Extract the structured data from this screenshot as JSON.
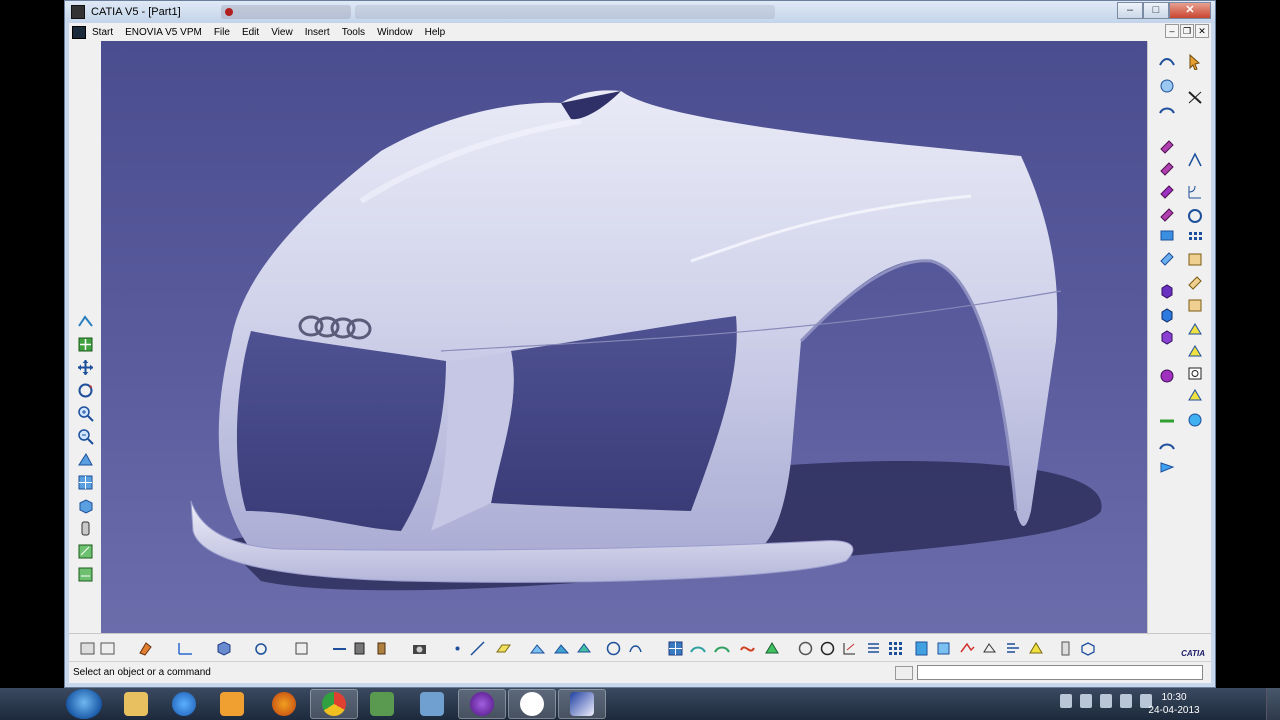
{
  "window": {
    "title": "CATIA V5 - [Part1]",
    "controls": {
      "minimize": "–",
      "maximize": "□",
      "close": "✕"
    },
    "inner_controls": {
      "minimize": "–",
      "restore": "❐",
      "close": "✕"
    }
  },
  "menu": {
    "items": [
      "Start",
      "ENOVIA V5 VPM",
      "File",
      "Edit",
      "View",
      "Insert",
      "Tools",
      "Window",
      "Help"
    ]
  },
  "left_toolbar": {
    "icons": [
      "fly-mode-icon",
      "fit-all-icon",
      "pan-icon",
      "rotate-icon",
      "zoom-in-icon",
      "zoom-out-icon",
      "normal-view-icon",
      "multi-view-icon",
      "isometric-view-icon",
      "shading-icon",
      "hide-show-icon",
      "swap-space-icon"
    ]
  },
  "right_toolbar": {
    "icons": [
      "sketcher-icon",
      "select-icon",
      "pad-icon",
      "pocket-icon",
      "shaft-icon",
      "groove-icon",
      "hole-icon",
      "rib-icon",
      "slot-icon",
      "stiffener-icon",
      "multi-section-icon",
      "remove-icon",
      "fillet-icon",
      "chamfer-icon",
      "draft-icon",
      "shell-icon",
      "thickness-icon",
      "thread-icon",
      "split-icon",
      "thick-surface-icon",
      "close-surface-icon",
      "sew-surface-icon",
      "translate-icon",
      "rotate-part-icon",
      "symmetry-icon",
      "mirror-icon",
      "pattern-icon",
      "scale-icon",
      "measure-icon",
      "apply-material-icon"
    ]
  },
  "bottom_toolbar": {
    "icons": [
      "update-icon",
      "tree-icon",
      "paint-icon",
      "axis-icon",
      "part-body-icon",
      "boolean-icon",
      "catalog-icon",
      "measure-between-icon",
      "measure-item-icon",
      "inertia-icon",
      "camera-icon",
      "point-icon",
      "line-icon",
      "plane-icon",
      "projection-icon",
      "intersection-icon",
      "circle-icon",
      "spline-icon",
      "grid-icon",
      "analysis-icon",
      "curvature-icon",
      "draft-analysis-icon",
      "connect-icon",
      "boundary-icon",
      "compass-icon",
      "snap-icon",
      "table-icon",
      "tools-palette-icon",
      "publish-icon",
      "constraints-icon",
      "formula-icon",
      "knowledge-icon",
      "lock-icon",
      "render-icon",
      "macro-icon"
    ],
    "logo_text": "CATIA"
  },
  "status_bar": {
    "message": "Select an object or a command",
    "command_input": ""
  },
  "taskbar": {
    "apps": [
      "file-explorer",
      "internet-explorer",
      "media-player",
      "firefox",
      "chrome",
      "messenger",
      "paint",
      "bittorrent",
      "google-talk",
      "catia"
    ],
    "active_app": "catia",
    "time": "10:30",
    "date": "24-04-2013"
  },
  "colors": {
    "viewport_top": "#4a4d8f",
    "viewport_bottom": "#6b6dab",
    "model_surface": "#d7d9ee",
    "shadow": "#2e2f5c"
  }
}
